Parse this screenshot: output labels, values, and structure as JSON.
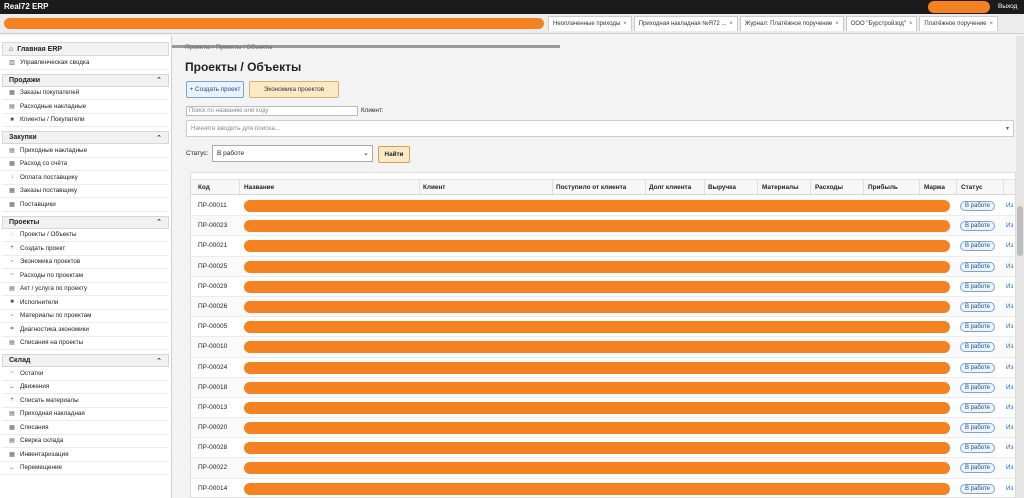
{
  "app": {
    "brand": "Real72 ERP",
    "logout": "Выход"
  },
  "tabs": [
    {
      "label": "Неоплаченные приходы"
    },
    {
      "label": "Приходная накладная №Я72 ..."
    },
    {
      "label": "Журнал: Платёжное поручение"
    },
    {
      "label": "ООО \"Бурстройзод\""
    },
    {
      "label": "Платёжное поручение"
    }
  ],
  "sidebar": {
    "home": "Главная ERP",
    "summary": "Управленческая сводка",
    "sections": [
      {
        "title": "Продажи",
        "items": [
          {
            "label": "Заказы покупателей",
            "icon": "▦"
          },
          {
            "label": "Расходные накладные",
            "icon": "▤"
          },
          {
            "label": "Клиенты / Покупатели",
            "icon": "■"
          }
        ]
      },
      {
        "title": "Закупки",
        "items": [
          {
            "label": "Приходные накладные",
            "icon": "▤"
          },
          {
            "label": "Расход со счёта",
            "icon": "▦"
          },
          {
            "label": "Оплата поставщику",
            "icon": "↓"
          },
          {
            "label": "Заказы поставщику",
            "icon": "▦"
          },
          {
            "label": "Поставщики",
            "icon": "▦"
          }
        ]
      },
      {
        "title": "Проекты",
        "items": [
          {
            "label": "Проекты / Объекты",
            "icon": "◌"
          },
          {
            "label": "Создать проект",
            "icon": "+"
          },
          {
            "label": "Экономика проектов",
            "icon": "~"
          },
          {
            "label": "Расходы по проектам",
            "icon": "~"
          },
          {
            "label": "Акт / услуга по проекту",
            "icon": "▤"
          },
          {
            "label": "Исполнители",
            "icon": "■"
          },
          {
            "label": "Материалы по проектам",
            "icon": "~"
          },
          {
            "label": "Диагностика экономики",
            "icon": "⌗"
          },
          {
            "label": "Списания на проекты",
            "icon": "▤"
          }
        ]
      },
      {
        "title": "Склад",
        "items": [
          {
            "label": "Остатки",
            "icon": "~"
          },
          {
            "label": "Движения",
            "icon": "↔"
          },
          {
            "label": "Списать материалы",
            "icon": "+"
          },
          {
            "label": "Приходная накладная",
            "icon": "▤"
          },
          {
            "label": "Списания",
            "icon": "▦"
          },
          {
            "label": "Сверка склада",
            "icon": "▤"
          },
          {
            "label": "Инвентаризация",
            "icon": "▦"
          },
          {
            "label": "Перемещение",
            "icon": "↔"
          }
        ]
      }
    ]
  },
  "main": {
    "breadcrumb": "Проекты › Проекты / Объекты",
    "title": "Проекты / Объекты",
    "create_button": "+ Создать проект",
    "economy_button": "Экономика проектов",
    "search_placeholder": "Поиск по названию или коду",
    "client_label": "Клиент:",
    "client_placeholder": "Начните вводить для поиска...",
    "status_label": "Статус:",
    "status_value": "В работе",
    "find_button": "Найти"
  },
  "table": {
    "columns": [
      "Код",
      "Название",
      "Клиент",
      "Поступило от клиента",
      "Долг клиента",
      "Выручка",
      "Материалы",
      "Расходы",
      "Прибыль",
      "Маржа",
      "Статус"
    ],
    "action_label": "Из",
    "rows": [
      {
        "code": "ПР-00011",
        "status": "В работе"
      },
      {
        "code": "ПР-00023",
        "status": "В работе"
      },
      {
        "code": "ПР-00021",
        "status": "В работе"
      },
      {
        "code": "ПР-00025",
        "status": "В работе"
      },
      {
        "code": "ПР-00029",
        "status": "В работе"
      },
      {
        "code": "ПР-00026",
        "status": "В работе"
      },
      {
        "code": "ПР-00005",
        "status": "В работе"
      },
      {
        "code": "ПР-00010",
        "status": "В работе"
      },
      {
        "code": "ПР-00024",
        "status": "В работе"
      },
      {
        "code": "ПР-00018",
        "status": "В работе"
      },
      {
        "code": "ПР-00013",
        "status": "В работе"
      },
      {
        "code": "ПР-00020",
        "status": "В работе"
      },
      {
        "code": "ПР-00028",
        "status": "В работе"
      },
      {
        "code": "ПР-00022",
        "status": "В работе"
      },
      {
        "code": "ПР-00014",
        "status": "В работе"
      }
    ]
  },
  "colors": {
    "redaction": "#f58220",
    "accent": "#1a4f95",
    "topbar": "#1b1b1b"
  }
}
